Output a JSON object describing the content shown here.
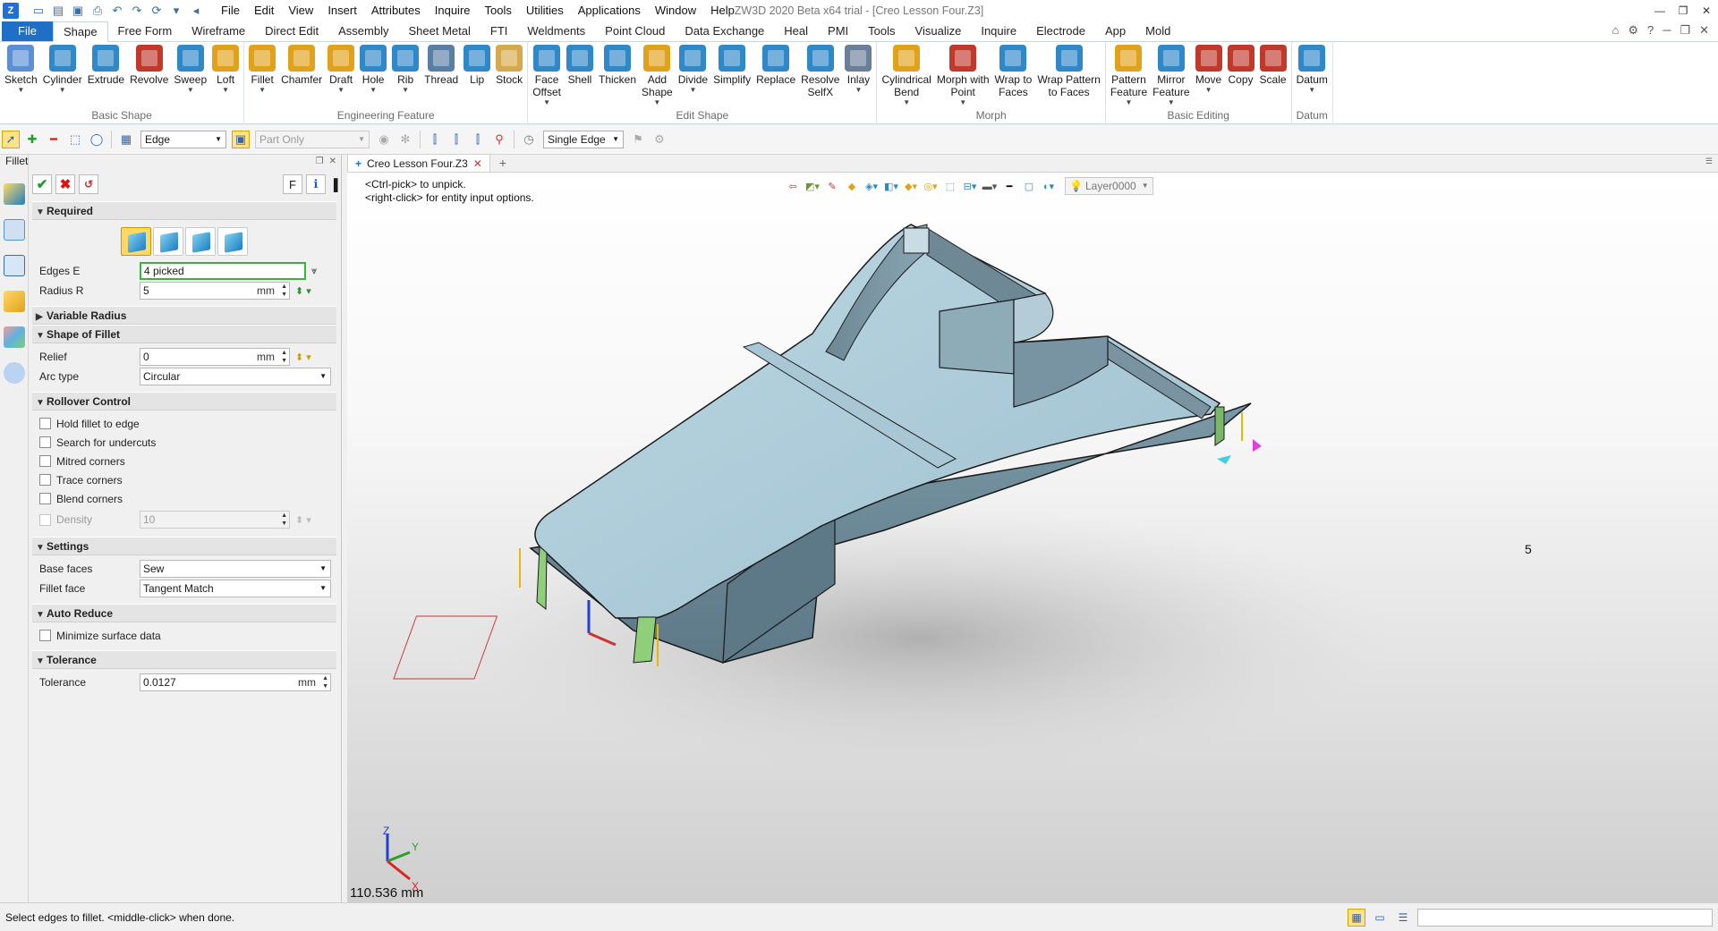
{
  "window": {
    "title": "ZW3D 2020 Beta x64 trial - [Creo Lesson Four.Z3]",
    "logo_text": "Z",
    "controls": [
      "—",
      "❐",
      "✕"
    ]
  },
  "menubar": [
    "File",
    "Edit",
    "View",
    "Insert",
    "Attributes",
    "Inquire",
    "Tools",
    "Utilities",
    "Applications",
    "Window",
    "Help"
  ],
  "ribbon_tabs": {
    "file": "File",
    "tabs": [
      "Shape",
      "Free Form",
      "Wireframe",
      "Direct Edit",
      "Assembly",
      "Sheet Metal",
      "FTI",
      "Weldments",
      "Point Cloud",
      "Data Exchange",
      "Heal",
      "PMI",
      "Tools",
      "Visualize",
      "Inquire",
      "Electrode",
      "App",
      "Mold"
    ],
    "active": "Shape"
  },
  "ribbon_groups": [
    {
      "label": "Basic Shape",
      "buttons": [
        {
          "l1": "Sketch",
          "l2": "",
          "caret": true,
          "color": "#5b8fd6"
        },
        {
          "l1": "Cylinder",
          "l2": "",
          "caret": true,
          "color": "#2f88c8"
        },
        {
          "l1": "Extrude",
          "l2": "",
          "caret": false,
          "color": "#2f88c8"
        },
        {
          "l1": "Revolve",
          "l2": "",
          "caret": false,
          "color": "#c0392b"
        },
        {
          "l1": "Sweep",
          "l2": "",
          "caret": true,
          "color": "#2f88c8"
        },
        {
          "l1": "Loft",
          "l2": "",
          "caret": true,
          "color": "#e0a21b"
        }
      ]
    },
    {
      "label": "Engineering Feature",
      "buttons": [
        {
          "l1": "Fillet",
          "l2": "",
          "caret": true,
          "color": "#e0a21b"
        },
        {
          "l1": "Chamfer",
          "l2": "",
          "caret": false,
          "color": "#e0a21b"
        },
        {
          "l1": "Draft",
          "l2": "",
          "caret": true,
          "color": "#e0a21b"
        },
        {
          "l1": "Hole",
          "l2": "",
          "caret": true,
          "color": "#2f88c8"
        },
        {
          "l1": "Rib",
          "l2": "",
          "caret": true,
          "color": "#2f88c8"
        },
        {
          "l1": "Thread",
          "l2": "",
          "caret": false,
          "color": "#5a7fa5"
        },
        {
          "l1": "Lip",
          "l2": "",
          "caret": false,
          "color": "#2f88c8"
        },
        {
          "l1": "Stock",
          "l2": "",
          "caret": false,
          "color": "#d6a94a"
        }
      ]
    },
    {
      "label": "Edit Shape",
      "buttons": [
        {
          "l1": "Face",
          "l2": "Offset",
          "caret": true,
          "color": "#2f88c8"
        },
        {
          "l1": "Shell",
          "l2": "",
          "caret": false,
          "color": "#2f88c8"
        },
        {
          "l1": "Thicken",
          "l2": "",
          "caret": false,
          "color": "#2f88c8"
        },
        {
          "l1": "Add",
          "l2": "Shape",
          "caret": true,
          "color": "#e0a21b"
        },
        {
          "l1": "Divide",
          "l2": "",
          "caret": true,
          "color": "#2f88c8"
        },
        {
          "l1": "Simplify",
          "l2": "",
          "caret": false,
          "color": "#2f88c8"
        },
        {
          "l1": "Replace",
          "l2": "",
          "caret": false,
          "color": "#2f88c8"
        },
        {
          "l1": "Resolve",
          "l2": "SelfX",
          "caret": false,
          "color": "#2f88c8"
        },
        {
          "l1": "Inlay",
          "l2": "",
          "caret": true,
          "color": "#6b7f9a"
        }
      ]
    },
    {
      "label": "Morph",
      "buttons": [
        {
          "l1": "Cylindrical",
          "l2": "Bend",
          "caret": true,
          "color": "#e0a21b"
        },
        {
          "l1": "Morph with",
          "l2": "Point",
          "caret": true,
          "color": "#c0392b"
        },
        {
          "l1": "Wrap to",
          "l2": "Faces",
          "caret": false,
          "color": "#2f88c8"
        },
        {
          "l1": "Wrap Pattern",
          "l2": "to Faces",
          "caret": false,
          "color": "#2f88c8"
        }
      ]
    },
    {
      "label": "Basic Editing",
      "buttons": [
        {
          "l1": "Pattern",
          "l2": "Feature",
          "caret": true,
          "color": "#e0a21b"
        },
        {
          "l1": "Mirror",
          "l2": "Feature",
          "caret": true,
          "color": "#2f88c8"
        },
        {
          "l1": "Move",
          "l2": "",
          "caret": true,
          "color": "#c0392b"
        },
        {
          "l1": "Copy",
          "l2": "",
          "caret": false,
          "color": "#c0392b"
        },
        {
          "l1": "Scale",
          "l2": "",
          "caret": false,
          "color": "#c0392b"
        }
      ]
    },
    {
      "label": "Datum",
      "buttons": [
        {
          "l1": "Datum",
          "l2": "",
          "caret": true,
          "color": "#2f88c8"
        }
      ]
    }
  ],
  "filterbar": {
    "filter_select": "Edge",
    "scope_select": "Part Only",
    "pick_select": "Single Edge"
  },
  "panel": {
    "title": "Fillet",
    "help_button": "F",
    "sections": {
      "required": "Required",
      "variable_radius": "Variable Radius",
      "shape_of_fillet": "Shape of Fillet",
      "rollover_control": "Rollover Control",
      "settings": "Settings",
      "auto_reduce": "Auto Reduce",
      "tolerance": "Tolerance"
    },
    "fields": {
      "edges_label": "Edges E",
      "edges_value": "4 picked",
      "radius_label": "Radius R",
      "radius_value": "5",
      "radius_unit": "mm",
      "relief_label": "Relief",
      "relief_value": "0",
      "relief_unit": "mm",
      "arc_label": "Arc type",
      "arc_value": "Circular",
      "density_label": "Density",
      "density_value": "10",
      "base_faces_label": "Base faces",
      "base_faces_value": "Sew",
      "fillet_face_label": "Fillet face",
      "fillet_face_value": "Tangent Match",
      "tolerance_label": "Tolerance",
      "tolerance_value": "0.0127",
      "tolerance_unit": "mm"
    },
    "checkboxes": {
      "hold": "Hold fillet to edge",
      "undercuts": "Search for undercuts",
      "mitred": "Mitred corners",
      "trace": "Trace corners",
      "blend": "Blend corners",
      "minimize": "Minimize surface data"
    }
  },
  "document": {
    "tab_label": "Creo Lesson Four.Z3",
    "hint_line1": "<Ctrl-pick> to unpick.",
    "hint_line2": "<right-click> for entity input options.",
    "layer": "Layer0000",
    "measure": "110.536 mm",
    "dim_value": "5",
    "axes": {
      "x": "X",
      "y": "Y",
      "z": "Z"
    }
  },
  "status": {
    "text": "Select edges to fillet.  <middle-click> when done."
  }
}
